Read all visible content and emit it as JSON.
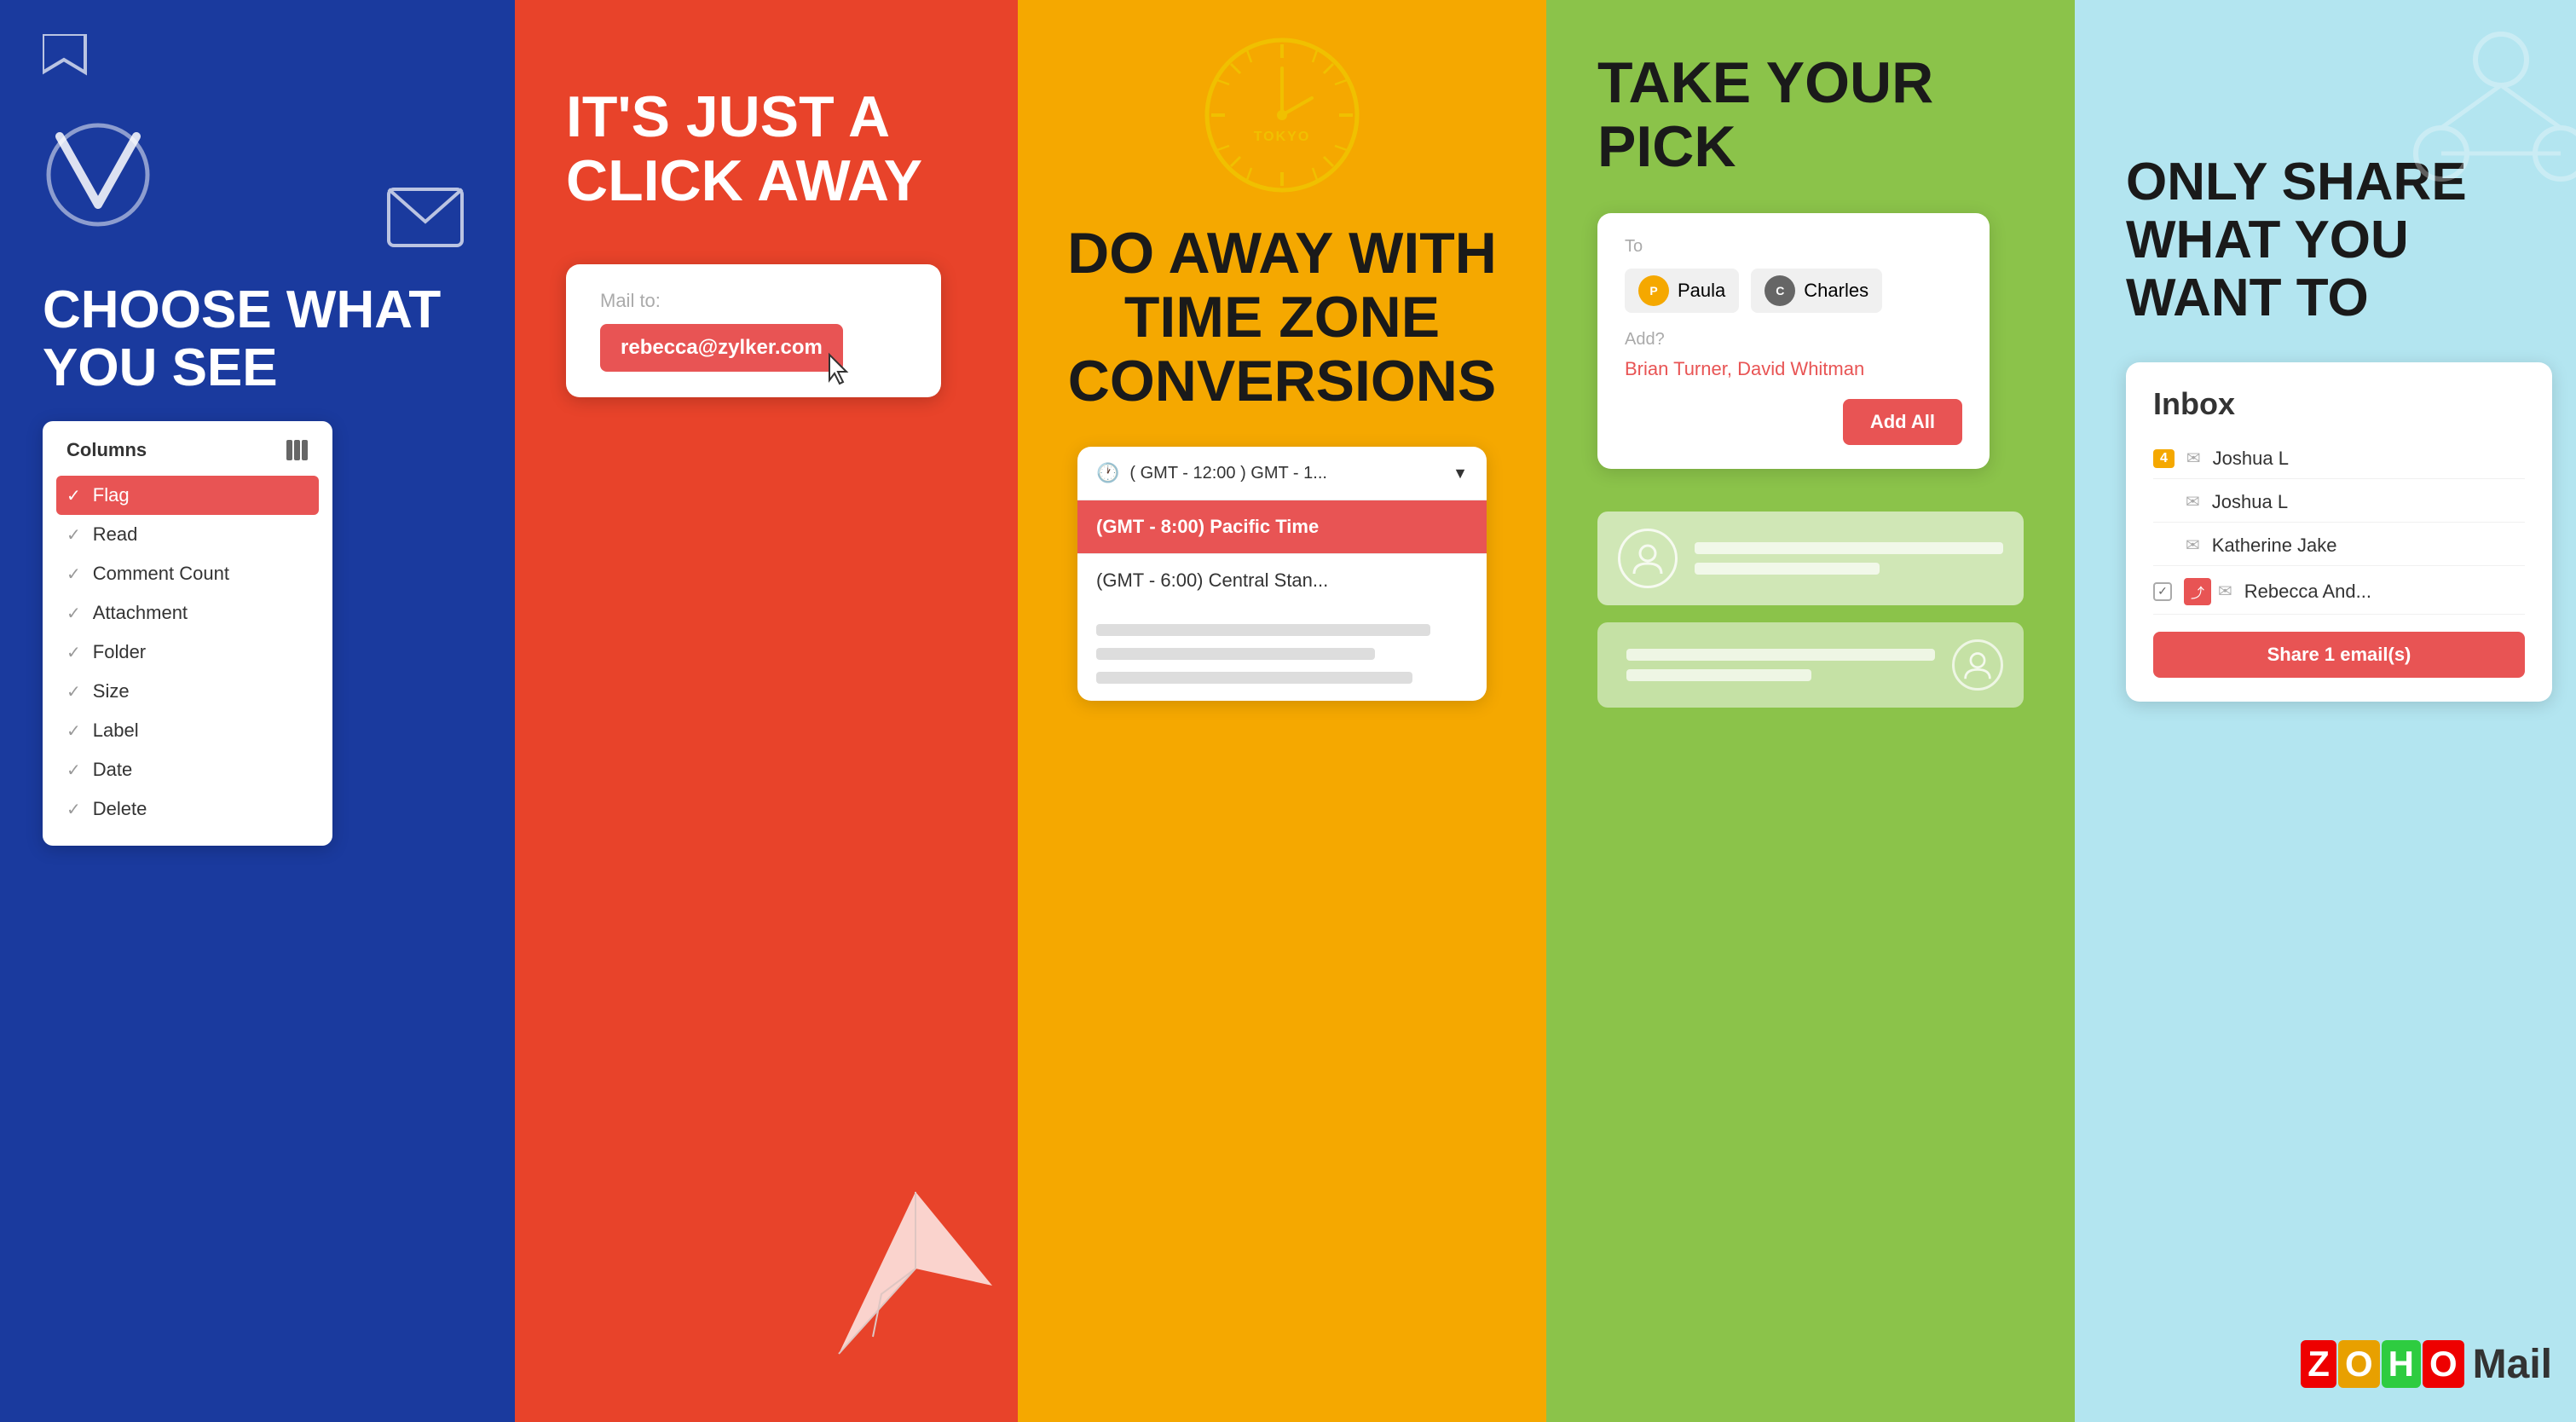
{
  "panel1": {
    "title": "CHOOSE WHAT YOU SEE",
    "card_title": "Columns",
    "list_items": [
      {
        "label": "Flag",
        "active": true
      },
      {
        "label": "Read",
        "active": false
      },
      {
        "label": "Comment Count",
        "active": false
      },
      {
        "label": "Attachment",
        "active": false
      },
      {
        "label": "Folder",
        "active": false
      },
      {
        "label": "Size",
        "active": false
      },
      {
        "label": "Label",
        "active": false
      },
      {
        "label": "Date",
        "active": false
      },
      {
        "label": "Delete",
        "active": false
      }
    ]
  },
  "panel2": {
    "title": "IT'S JUST A CLICK AWAY",
    "mail_label": "Mail to:",
    "email": "rebecca@zylker.com"
  },
  "panel3": {
    "title": "DO AWAY WITH TIME ZONE CONVERSIONS",
    "clock_label": "TOKYO",
    "dropdown_text": "( GMT - 12:00 ) GMT - 1...",
    "option_selected": "(GMT - 8:00) Pacific Time",
    "option_2": "(GMT - 6:00) Central Stan..."
  },
  "panel4": {
    "title": "TAKE YOUR PICK",
    "to_label": "To",
    "recipients": [
      "Paula",
      "Charles"
    ],
    "add_label": "Add?",
    "suggestions": "Brian Turner, David Whitman",
    "add_btn": "Add All"
  },
  "panel5": {
    "title": "ONLY SHARE WHAT YOU WANT TO",
    "card_title": "Inbox",
    "inbox_items": [
      {
        "badge": "4",
        "name": "Joshua L",
        "selected": false
      },
      {
        "badge": "",
        "name": "Joshua L",
        "selected": false
      },
      {
        "badge": "",
        "name": "Katherine Jake",
        "selected": false
      },
      {
        "badge": "",
        "name": "Rebecca And...",
        "selected": true,
        "shared": true
      }
    ],
    "share_btn": "Share 1 email(s)",
    "zoho_letters": [
      "Z",
      "O",
      "H",
      "O"
    ],
    "mail_text": "Mail"
  }
}
